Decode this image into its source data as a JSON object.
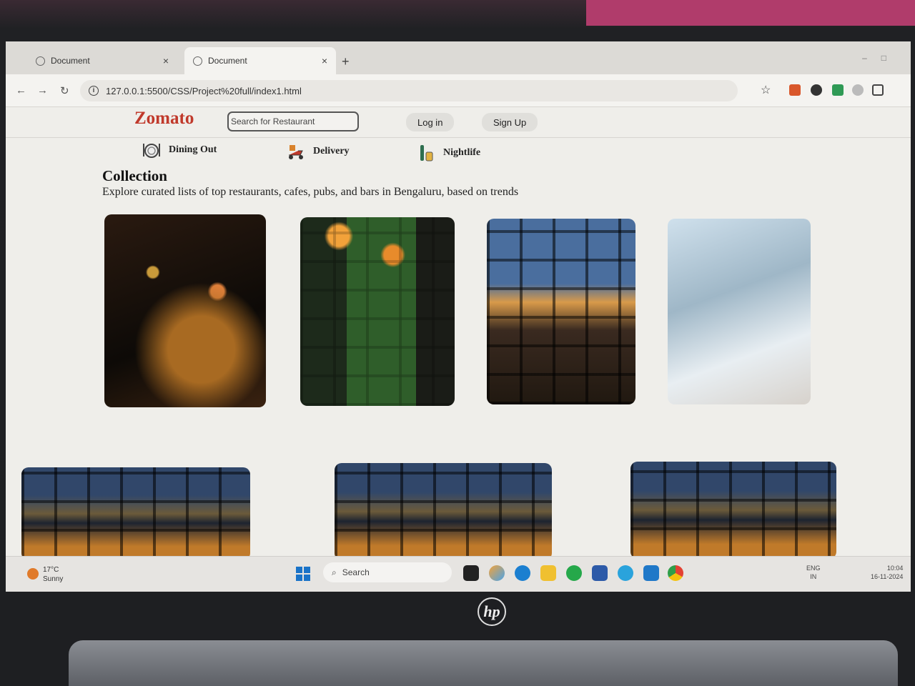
{
  "browser": {
    "tabs": [
      {
        "label": "Document",
        "close": "×",
        "active": false
      },
      {
        "label": "Document",
        "close": "×",
        "active": true
      }
    ],
    "new_tab": "+",
    "url": "127.0.0.1:5500/CSS/Project%20full/index1.html",
    "icons": [
      "back-icon",
      "forward-icon",
      "reload-icon",
      "info-icon",
      "star-icon",
      "extensions-icon"
    ]
  },
  "site": {
    "logo": "Zomato",
    "search_placeholder": "Search for Restaurant",
    "login": "Log in",
    "signup": "Sign Up",
    "nav": [
      {
        "label": "Dining Out",
        "icon": "dining-icon"
      },
      {
        "label": "Delivery",
        "icon": "scooter-icon"
      },
      {
        "label": "Nightlife",
        "icon": "drinks-icon"
      }
    ],
    "collection_title": "Collection",
    "collection_subtitle": "Explore curated lists of top restaurants, cafes, pubs, and bars in Bengaluru, based on trends",
    "cards": [
      "restaurant-photo",
      "restaurant-photo",
      "restaurant-photo",
      "restaurant-photo",
      "restaurant-photo",
      "restaurant-photo",
      "restaurant-photo"
    ]
  },
  "taskbar": {
    "weather_temp": "17°C",
    "weather_desc": "Sunny",
    "search": "Search",
    "lang": "ENG",
    "region": "IN",
    "time": "10:04",
    "date": "16-11-2024"
  },
  "device": {
    "brand": "hp"
  },
  "colors": {
    "logo": "#c0392b",
    "start": "#1a73c8"
  }
}
